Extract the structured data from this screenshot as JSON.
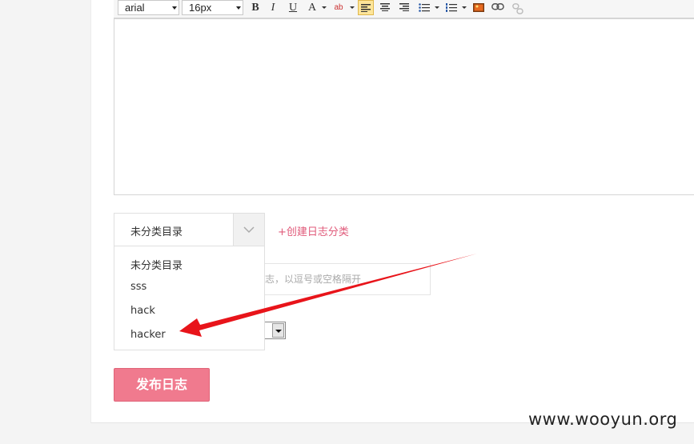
{
  "toolbar": {
    "font_family": "arial",
    "font_size": "16px",
    "bold": "B",
    "italic": "I",
    "underline": "U",
    "font_color": "A",
    "highlight": "ab"
  },
  "category": {
    "selected": "未分类目录",
    "create_link": "+创建日志分类",
    "options": [
      "未分类目录",
      "sss",
      "hack",
      "hacker"
    ]
  },
  "tags": {
    "placeholder": "志，以逗号或空格隔开"
  },
  "publish": {
    "label": "发布日志"
  },
  "watermark": "www.wooyun.org",
  "colors": {
    "accent": "#f07a8e",
    "link": "#e05a7a",
    "annotation_arrow": "#e8141a"
  }
}
